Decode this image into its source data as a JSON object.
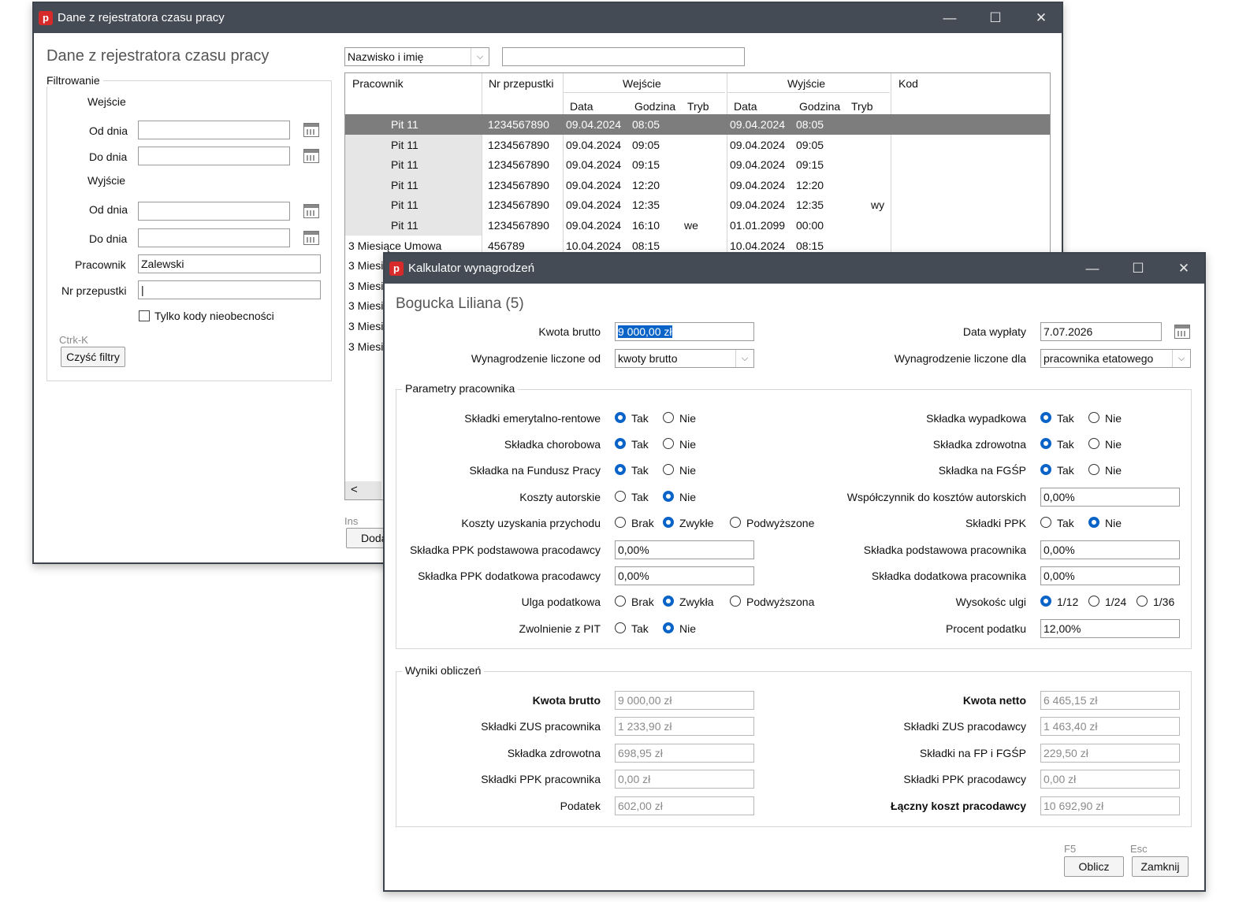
{
  "back": {
    "title": "Dane z rejestratora czasu pracy",
    "heading": "Dane z rejestratora czasu pracy",
    "filter_group": "Filtrowanie",
    "entry_label": "Wejście",
    "exit_label": "Wyjście",
    "from_label": "Od dnia",
    "to_label": "Do dnia",
    "employee_label": "Pracownik",
    "employee_value": "Zalewski",
    "pass_label": "Nr przepustki",
    "pass_value": "|",
    "only_absence_label": "Tylko kody nieobecności",
    "clear_hint": "Ctrk-K",
    "clear_button": "Czyść filtry",
    "sort_select": "Nazwisko i imię",
    "search_value": "",
    "add_hint": "Ins",
    "add_button": "Doda",
    "grid": {
      "headers": {
        "employee": "Pracownik",
        "pass": "Nr przepustki",
        "entry": "Wejście",
        "exit": "Wyjście",
        "code": "Kod",
        "date": "Data",
        "time": "Godzina",
        "mode": "Tryb"
      },
      "rows": [
        {
          "employee": "Pit 11",
          "pass": "1234567890",
          "in_date": "09.04.2024",
          "in_time": "08:05",
          "in_mode": "",
          "out_date": "09.04.2024",
          "out_time": "08:05",
          "out_mode": "",
          "code": ""
        },
        {
          "employee": "Pit 11",
          "pass": "1234567890",
          "in_date": "09.04.2024",
          "in_time": "09:05",
          "in_mode": "",
          "out_date": "09.04.2024",
          "out_time": "09:05",
          "out_mode": "",
          "code": ""
        },
        {
          "employee": "Pit 11",
          "pass": "1234567890",
          "in_date": "09.04.2024",
          "in_time": "09:15",
          "in_mode": "",
          "out_date": "09.04.2024",
          "out_time": "09:15",
          "out_mode": "",
          "code": ""
        },
        {
          "employee": "Pit 11",
          "pass": "1234567890",
          "in_date": "09.04.2024",
          "in_time": "12:20",
          "in_mode": "",
          "out_date": "09.04.2024",
          "out_time": "12:20",
          "out_mode": "",
          "code": ""
        },
        {
          "employee": "Pit 11",
          "pass": "1234567890",
          "in_date": "09.04.2024",
          "in_time": "12:35",
          "in_mode": "",
          "out_date": "09.04.2024",
          "out_time": "12:35",
          "out_mode": "wy",
          "code": ""
        },
        {
          "employee": "Pit 11",
          "pass": "1234567890",
          "in_date": "09.04.2024",
          "in_time": "16:10",
          "in_mode": "we",
          "out_date": "01.01.2099",
          "out_time": "00:00",
          "out_mode": "",
          "code": ""
        },
        {
          "employee": "3 Miesiące Umowa",
          "pass": "456789",
          "in_date": "10.04.2024",
          "in_time": "08:15",
          "in_mode": "",
          "out_date": "10.04.2024",
          "out_time": "08:15",
          "out_mode": "",
          "code": ""
        },
        {
          "employee": "3 Miesi"
        },
        {
          "employee": "3 Miesi"
        },
        {
          "employee": "3 Miesi"
        },
        {
          "employee": "3 Miesi"
        },
        {
          "employee": "3 Miesi"
        }
      ],
      "scroll_left": "<"
    }
  },
  "calc": {
    "title": "Kalkulator wynagrodzeń",
    "heading": "Bogucka Liliana (5)",
    "gross_label": "Kwota brutto",
    "gross_value": "9 000,00 zł",
    "pay_date_label": "Data wypłaty",
    "pay_date_value": "7.07.2026",
    "calc_from_label": "Wynagrodzenie liczone od",
    "calc_from_value": "kwoty brutto",
    "calc_for_label": "Wynagrodzenie liczone dla",
    "calc_for_value": "pracownika etatowego",
    "params_group": "Parametry pracownika",
    "yes": "Tak",
    "no": "Nie",
    "none": "Brak",
    "normal_m": "Zwykłe",
    "raised_n": "Podwyższone",
    "normal_f": "Zwykła",
    "raised_f": "Podwyższona",
    "params_left": {
      "pension": "Składki emerytalno-rentowe",
      "sickness": "Składka chorobowa",
      "labor_fund": "Składka na Fundusz Pracy",
      "author_costs": "Koszty autorskie",
      "income_costs": "Koszty uzyskania przychodu",
      "ppk_basic_employer": "Składka PPK podstawowa pracodawcy",
      "ppk_basic_employer_value": "0,00%",
      "ppk_extra_employer": "Składka PPK dodatkowa pracodawcy",
      "ppk_extra_employer_value": "0,00%",
      "tax_relief": "Ulga podatkowa",
      "pit_exempt": "Zwolnienie z PIT"
    },
    "params_right": {
      "accident": "Składka wypadkowa",
      "health": "Składka zdrowotna",
      "fgsp": "Składka na FGŚP",
      "author_ratio": "Współczynnik do kosztów autorskich",
      "author_ratio_value": "0,00%",
      "ppk": "Składki PPK",
      "employee_basic": "Składka podstawowa pracownika",
      "employee_basic_value": "0,00%",
      "employee_extra": "Składka dodatkowa pracownika",
      "employee_extra_value": "0,00%",
      "relief_amount": "Wysokośc ulgi",
      "r112": "1/12",
      "r124": "1/24",
      "r136": "1/36",
      "tax_rate": "Procent podatku",
      "tax_rate_value": "12,00%"
    },
    "results_group": "Wyniki obliczeń",
    "results_left": {
      "gross": "Kwota brutto",
      "gross_value": "9 000,00 zł",
      "zus_employee": "Składki  ZUS pracownika",
      "zus_employee_value": "1 233,90 zł",
      "health": "Składka zdrowotna",
      "health_value": "698,95 zł",
      "ppk_employee": "Składki PPK pracownika",
      "ppk_employee_value": "0,00 zł",
      "tax": "Podatek",
      "tax_value": "602,00 zł"
    },
    "results_right": {
      "net": "Kwota netto",
      "net_value": "6 465,15 zł",
      "zus_employer": "Składki  ZUS pracodawcy",
      "zus_employer_value": "1 463,40 zł",
      "fp_fgsp": "Składki na FP i FGŚP",
      "fp_fgsp_value": "229,50 zł",
      "ppk_employer": "Składki PPK pracodawcy",
      "ppk_employer_value": "0,00 zł",
      "total_cost": "Łączny koszt pracodawcy",
      "total_cost_value": "10 692,90 zł"
    },
    "calc_hint": "F5",
    "calc_button": "Oblicz",
    "close_hint": "Esc",
    "close_button": "Zamknij"
  },
  "icons": {
    "minimize": "—",
    "maximize": "☐",
    "close": "✕",
    "app": "p",
    "chevron": "⌵"
  },
  "colors": {
    "titlebar": "#444b55",
    "selected_row": "#7d7d7d",
    "radio_accent": "#0a64c8",
    "app_icon": "#d72a2a"
  }
}
